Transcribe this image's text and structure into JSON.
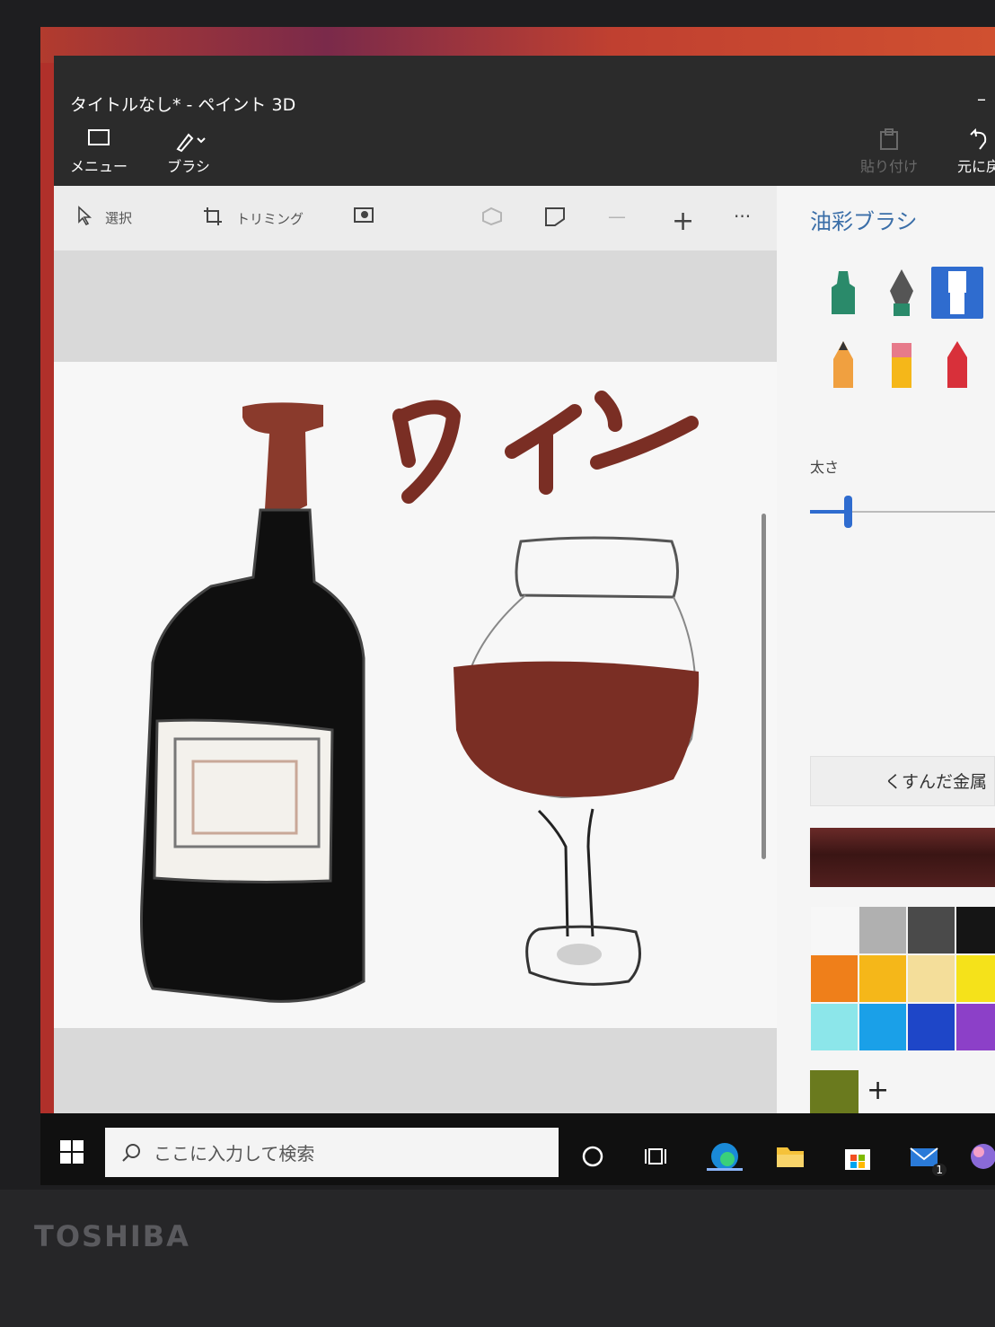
{
  "device": {
    "brand": "TOSHIBA"
  },
  "app": {
    "title": "タイトルなし* - ペイント 3D",
    "minimize_glyph": "–",
    "toolbar": [
      {
        "label": "メニュー",
        "icon": "menu-icon"
      },
      {
        "label": "ブラシ",
        "icon": "brush-icon"
      },
      {
        "label": "貼り付け",
        "icon": "paste-icon",
        "enabled": false
      },
      {
        "label": "元に戻",
        "icon": "undo-icon"
      }
    ],
    "canvas_toolbar": {
      "select_label": "選択",
      "crop_label": "トリミング",
      "zoom_out_glyph": "—",
      "zoom_in_glyph": "+",
      "more_glyph": "···"
    }
  },
  "canvas": {
    "drawing_text": "ワイン",
    "colors": {
      "wine": "#7a2e24",
      "bottle": "#0f0f0f",
      "cap": "#8a3a2c"
    }
  },
  "panel": {
    "title": "油彩ブラシ",
    "brushes": [
      "marker",
      "calligraphy-pen",
      "oil-brush",
      "pencil",
      "eraser",
      "crayon"
    ],
    "selected_brush": "oil-brush",
    "thickness_label": "太さ",
    "thickness_fraction": 0.2,
    "material_label": "くすんだ金属",
    "current_color": "#3a1514",
    "palette": [
      "#f7f7f7",
      "#b0b0b0",
      "#4a4a4a",
      "#151515",
      "#ef7f1a",
      "#f5b719",
      "#f4de9a",
      "#f5e21a",
      "#8ce6ea",
      "#1aa0e8",
      "#1e46c8",
      "#8c40c8"
    ],
    "custom_color": "#6a7a1e",
    "add_glyph": "+"
  },
  "taskbar": {
    "search_placeholder": "ここに入力して検索",
    "mail_badge": "1"
  }
}
